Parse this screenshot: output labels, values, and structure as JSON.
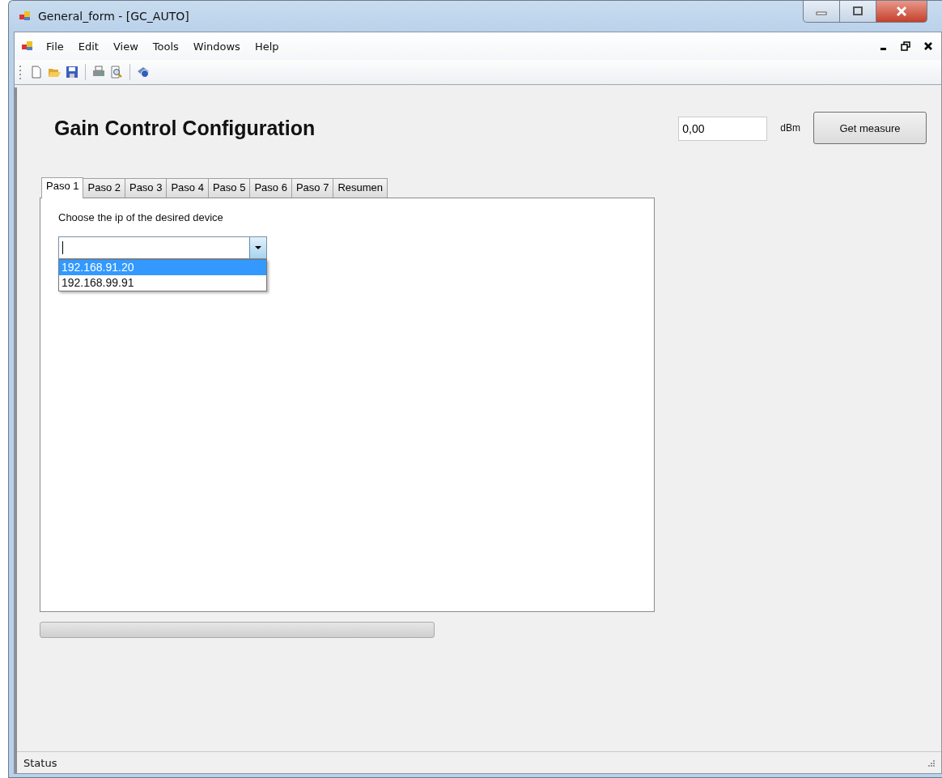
{
  "window": {
    "title": "General_form - [GC_AUTO]"
  },
  "menu": [
    {
      "label": "File"
    },
    {
      "label": "Edit"
    },
    {
      "label": "View"
    },
    {
      "label": "Tools"
    },
    {
      "label": "Windows"
    },
    {
      "label": "Help"
    }
  ],
  "heading": "Gain Control Configuration",
  "measure": {
    "value": "0,00",
    "unit": "dBm",
    "button": "Get measure"
  },
  "tabs": [
    {
      "label": "Paso 1",
      "selected": true
    },
    {
      "label": "Paso 2",
      "selected": false
    },
    {
      "label": "Paso 3",
      "selected": false
    },
    {
      "label": "Paso 4",
      "selected": false
    },
    {
      "label": "Paso 5",
      "selected": false
    },
    {
      "label": "Paso 6",
      "selected": false
    },
    {
      "label": "Paso 7",
      "selected": false
    },
    {
      "label": "Resumen",
      "selected": false
    }
  ],
  "panel": {
    "label": "Choose the ip of the desired device",
    "combo": {
      "expanded": true,
      "options": [
        {
          "label": "192.168.91.20",
          "selected": true
        },
        {
          "label": "192.168.99.91",
          "selected": false
        }
      ]
    }
  },
  "progress": {
    "level": 0
  },
  "status_bar": {
    "text": "Status"
  }
}
